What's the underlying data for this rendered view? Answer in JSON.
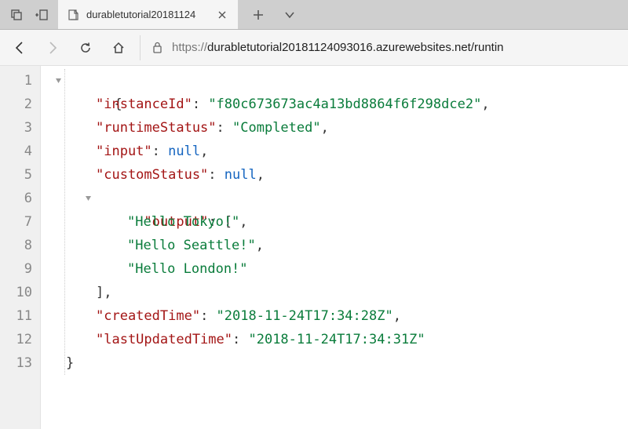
{
  "browser": {
    "tab_title": "durabletutorial20181124",
    "url_scheme": "https://",
    "url_rest": "durabletutorial20181124093016.azurewebsites.net/runtin"
  },
  "line_numbers": [
    "1",
    "2",
    "3",
    "4",
    "5",
    "6",
    "7",
    "8",
    "9",
    "10",
    "11",
    "12",
    "13"
  ],
  "json_view": {
    "k_instanceId": "\"instanceId\"",
    "v_instanceId": "\"f80c673673ac4a13bd8864f6f298dce2\"",
    "k_runtimeStatus": "\"runtimeStatus\"",
    "v_runtimeStatus": "\"Completed\"",
    "k_input": "\"input\"",
    "v_null": "null",
    "k_customStatus": "\"customStatus\"",
    "k_output": "\"output\"",
    "v_out0": "\"Hello Tokyo!\"",
    "v_out1": "\"Hello Seattle!\"",
    "v_out2": "\"Hello London!\"",
    "k_createdTime": "\"createdTime\"",
    "v_createdTime": "\"2018-11-24T17:34:28Z\"",
    "k_lastUpdatedTime": "\"lastUpdatedTime\"",
    "v_lastUpdatedTime": "\"2018-11-24T17:34:31Z\""
  }
}
